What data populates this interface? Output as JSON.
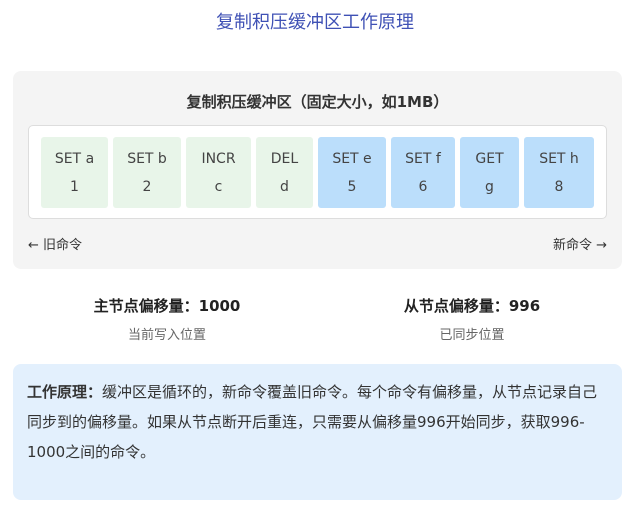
{
  "title": "复制积压缓冲区工作原理",
  "buffer": {
    "title": "复制积压缓冲区（固定大小，如1MB）",
    "cells": [
      {
        "cmd": "SET a",
        "arg": "1",
        "state": "old"
      },
      {
        "cmd": "SET b",
        "arg": "2",
        "state": "old"
      },
      {
        "cmd": "INCR",
        "arg": "c",
        "state": "old"
      },
      {
        "cmd": "DEL",
        "arg": "d",
        "state": "old"
      },
      {
        "cmd": "SET e",
        "arg": "5",
        "state": "new"
      },
      {
        "cmd": "SET f",
        "arg": "6",
        "state": "new"
      },
      {
        "cmd": "GET",
        "arg": "g",
        "state": "new"
      },
      {
        "cmd": "SET h",
        "arg": "8",
        "state": "new"
      }
    ],
    "old_label": "← 旧命令",
    "new_label": "新命令 →"
  },
  "master": {
    "value": "主节点偏移量：1000",
    "sub": "当前写入位置"
  },
  "slave": {
    "value": "从节点偏移量：996",
    "sub": "已同步位置"
  },
  "info": {
    "label": "工作原理：",
    "text": "缓冲区是循环的，新命令覆盖旧命令。每个命令有偏移量，从节点记录自己同步到的偏移量。如果从节点断开后重连，只需要从偏移量996开始同步，获取996-1000之间的命令。"
  },
  "colors": {
    "old": "#e8f5e9",
    "new": "#bbdefb",
    "title": "#3f51b5"
  }
}
